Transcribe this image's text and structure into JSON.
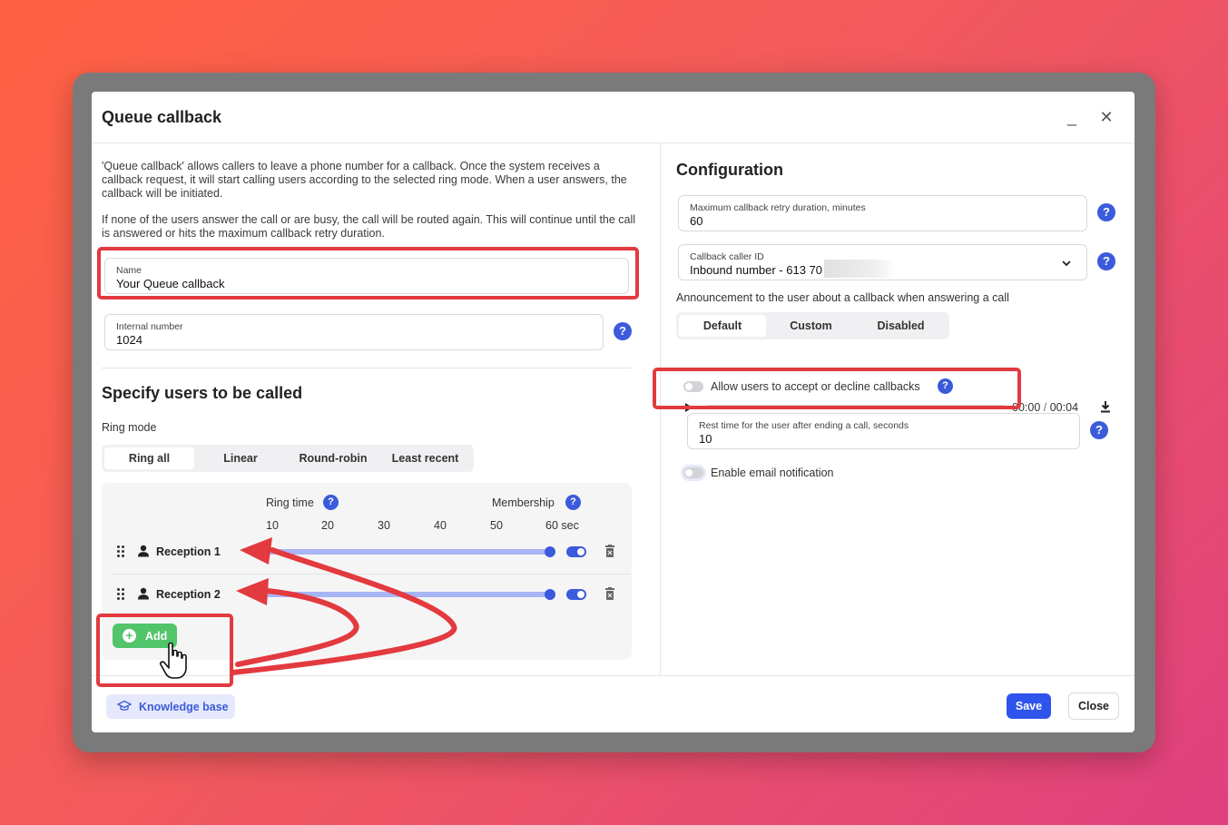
{
  "dialog": {
    "title": "Queue callback",
    "minimize_glyph": "_",
    "close_glyph": "✕"
  },
  "left": {
    "desc1": "'Queue callback' allows callers to leave a phone number for a callback. Once the system receives a callback request, it will start calling users according to the selected ring mode. When a user answers, the callback will be initiated.",
    "desc2": "If none of the users answer the call or are busy, the call will be routed again. This will continue until the call is answered or hits the maximum callback retry duration.",
    "name_field": {
      "label": "Name",
      "value": "Your Queue callback"
    },
    "internal_field": {
      "label": "Internal number",
      "value": "1024"
    },
    "users_title": "Specify users to be called",
    "ring_mode_label": "Ring mode",
    "ring_modes": [
      "Ring all",
      "Linear",
      "Round-robin",
      "Least recent"
    ],
    "ring_time_label": "Ring time",
    "membership_label": "Membership",
    "ticks": [
      "10",
      "20",
      "30",
      "40",
      "50",
      "60 sec"
    ],
    "users": [
      {
        "name": "Reception 1",
        "ring_time": 60,
        "enabled": true
      },
      {
        "name": "Reception 2",
        "ring_time": 60,
        "enabled": true
      }
    ],
    "add_label": "Add"
  },
  "right": {
    "title": "Configuration",
    "retry_field": {
      "label": "Maximum callback retry duration, minutes",
      "value": "60"
    },
    "caller_id_field": {
      "label": "Callback caller ID",
      "value": "Inbound number - 613 70"
    },
    "announcement_label": "Announcement to the user about a callback when answering a call",
    "announcement_modes": [
      "Default",
      "Custom",
      "Disabled"
    ],
    "audio": {
      "current": "00:00",
      "separator": "/",
      "total": "00:04"
    },
    "allow_label": "Allow users to accept or decline callbacks",
    "rest_field": {
      "label": "Rest time for the user after ending a call, seconds",
      "value": "10"
    },
    "email_label": "Enable email notification"
  },
  "footer": {
    "kb_label": "Knowledge base",
    "save_label": "Save",
    "close_label": "Close"
  },
  "help_glyph": "?",
  "colors": {
    "accent": "#3b5bdb",
    "add_green": "#52c46a",
    "annotation_red": "#e23a3f"
  }
}
